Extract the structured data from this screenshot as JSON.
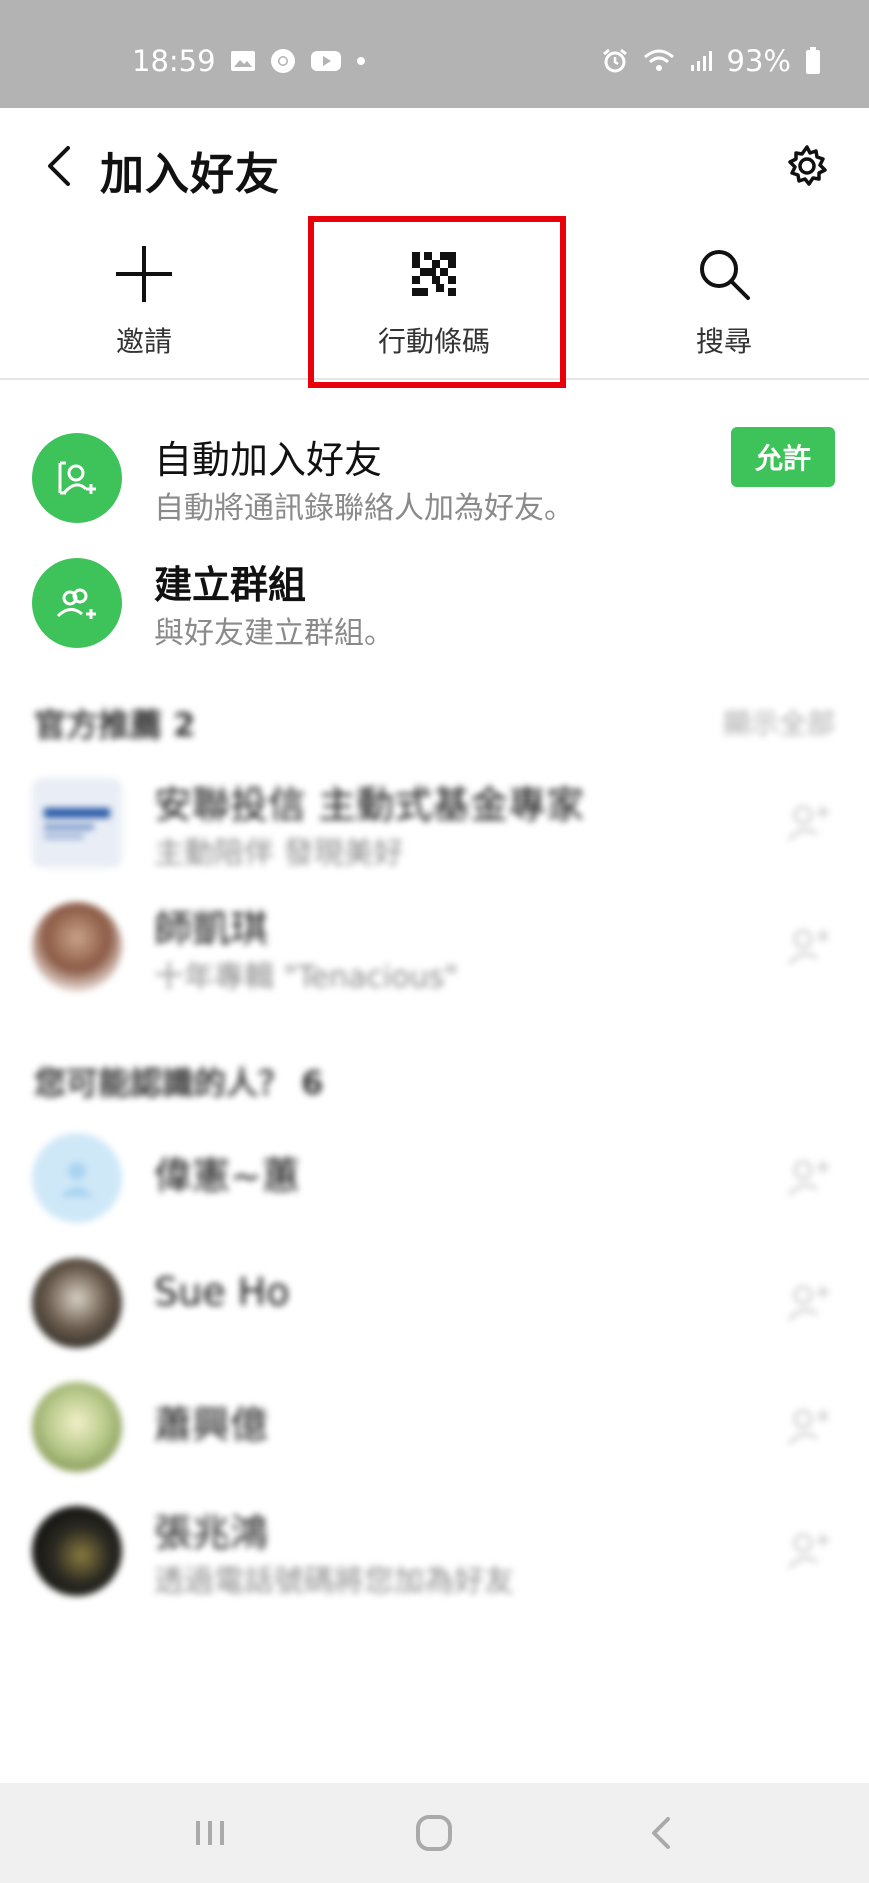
{
  "status_bar": {
    "time": "18:59",
    "battery": "93%"
  },
  "header": {
    "title": "加入好友"
  },
  "actions": [
    {
      "label": "邀請",
      "icon": "plus-icon"
    },
    {
      "label": "行動條碼",
      "icon": "qr-code-icon"
    },
    {
      "label": "搜尋",
      "icon": "search-icon"
    }
  ],
  "auto_add": {
    "name": "自動加入好友",
    "sub": "自動將通訊錄聯絡人加為好友。",
    "button": "允許"
  },
  "create_group": {
    "name": "建立群組",
    "sub": "與好友建立群組。"
  },
  "official": {
    "title": "官方推薦 2",
    "link": "顯示全部",
    "items": [
      {
        "name": "安聯投信 主動式基金專家",
        "sub": "主動陪伴 發現美好"
      },
      {
        "name": "師凱琪",
        "sub": "十年專輯 \"Tenacious\""
      }
    ]
  },
  "suggested": {
    "title": "您可能認識的人？ 6",
    "items": [
      {
        "name": "偉憲~蕙",
        "sub": ""
      },
      {
        "name": "Sue Ho",
        "sub": ""
      },
      {
        "name": "蕭興億",
        "sub": ""
      },
      {
        "name": "張兆鴻",
        "sub": "透過電話號碼將您加為好友"
      }
    ]
  },
  "colors": {
    "accent_green": "#3ec25a",
    "highlight_red": "#e8000b",
    "status_bar": "#b3b3b3"
  }
}
